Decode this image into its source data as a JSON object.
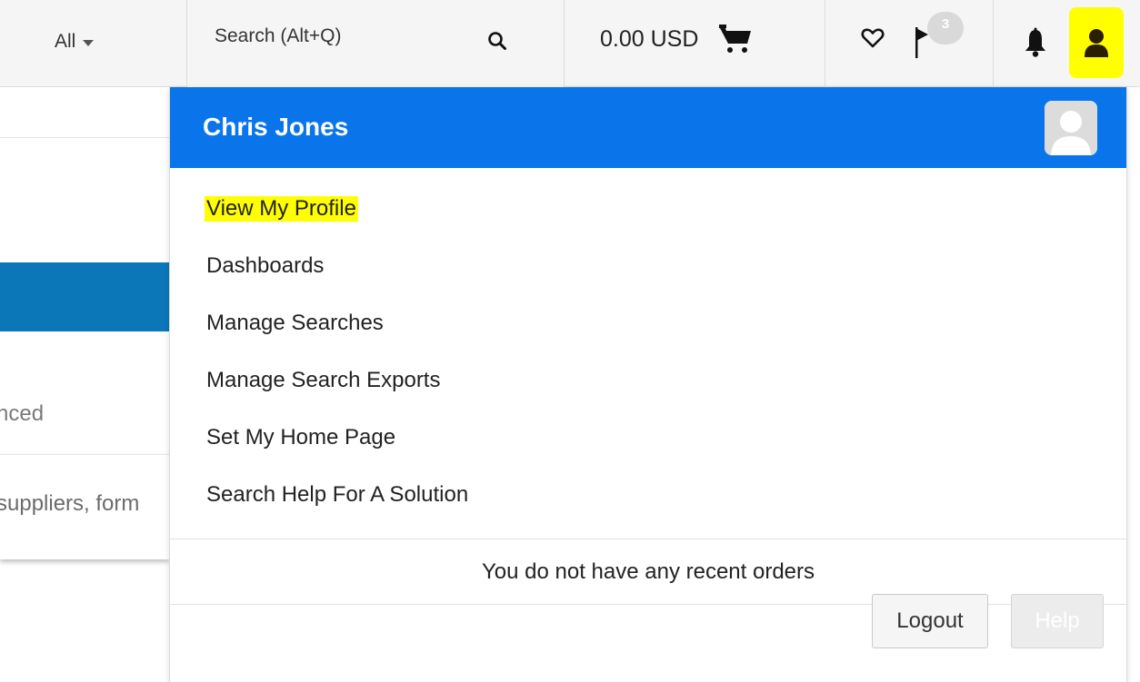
{
  "topbar": {
    "scope_label": "All",
    "search_placeholder": "Search (Alt+Q)",
    "cart_total": "0.00 USD",
    "flag_count": "3"
  },
  "background": {
    "advanced_text": "nced",
    "input_placeholder": "suppliers, form"
  },
  "profile_menu": {
    "user_name": "Chris Jones",
    "items": [
      {
        "label": "View My Profile",
        "highlighted": true
      },
      {
        "label": "Dashboards"
      },
      {
        "label": "Manage Searches"
      },
      {
        "label": "Manage Search Exports"
      },
      {
        "label": "Set My Home Page"
      },
      {
        "label": "Search Help For A Solution"
      }
    ],
    "recent_orders_text": "You do not have any recent orders",
    "logout_label": "Logout",
    "help_label": "Help"
  },
  "colors": {
    "header_blue": "#0a75ea",
    "highlight_yellow": "#ffff00",
    "page_blue_bar": "#0b77b8"
  },
  "icons": [
    "search-icon",
    "cart-icon",
    "heart-icon",
    "flag-icon",
    "bell-icon",
    "user-icon",
    "avatar-placeholder-icon"
  ]
}
